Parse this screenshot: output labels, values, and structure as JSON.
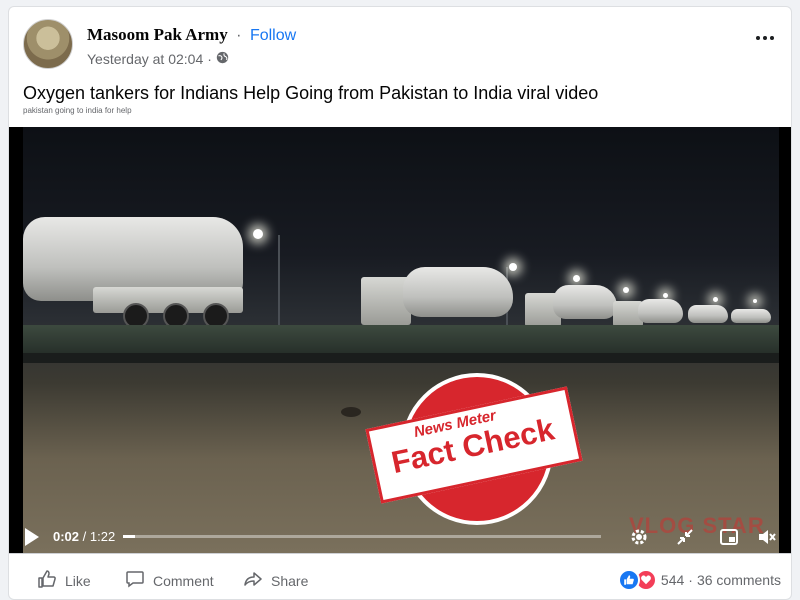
{
  "post": {
    "author": "Masoom Pak Army",
    "separator": "·",
    "follow_label": "Follow",
    "timestamp": "Yesterday at 02:04",
    "meta_separator": "·",
    "title": "Oxygen tankers for Indians Help Going from Pakistan to India viral video",
    "subtitle": "pakistan going to india for help"
  },
  "icons": {
    "more": "more-options-icon",
    "globe": "globe-icon",
    "play": "play-icon",
    "settings": "gear-icon",
    "fullscreen_shrink": "minimize-icon",
    "pip": "picture-in-picture-icon",
    "volume": "volume-muted-icon",
    "like": "thumbs-up-icon",
    "comment": "comment-icon",
    "share": "share-icon"
  },
  "video": {
    "current_time": "0:02",
    "time_separator": "/",
    "duration": "1:22",
    "progress_fraction": 0.025,
    "watermark_text": "VLOG STAR",
    "stamp": {
      "top_text": "News  Meter",
      "main_text": "Fact Check"
    }
  },
  "actions": {
    "like_label": "Like",
    "comment_label": "Comment",
    "share_label": "Share"
  },
  "stats": {
    "reaction_count": "544",
    "separator": "·",
    "comments": "36 comments"
  },
  "colors": {
    "accent": "#1877f2",
    "like_blue": "#1877f2",
    "love_red": "#f33e58",
    "stamp_red": "#d7262d"
  }
}
